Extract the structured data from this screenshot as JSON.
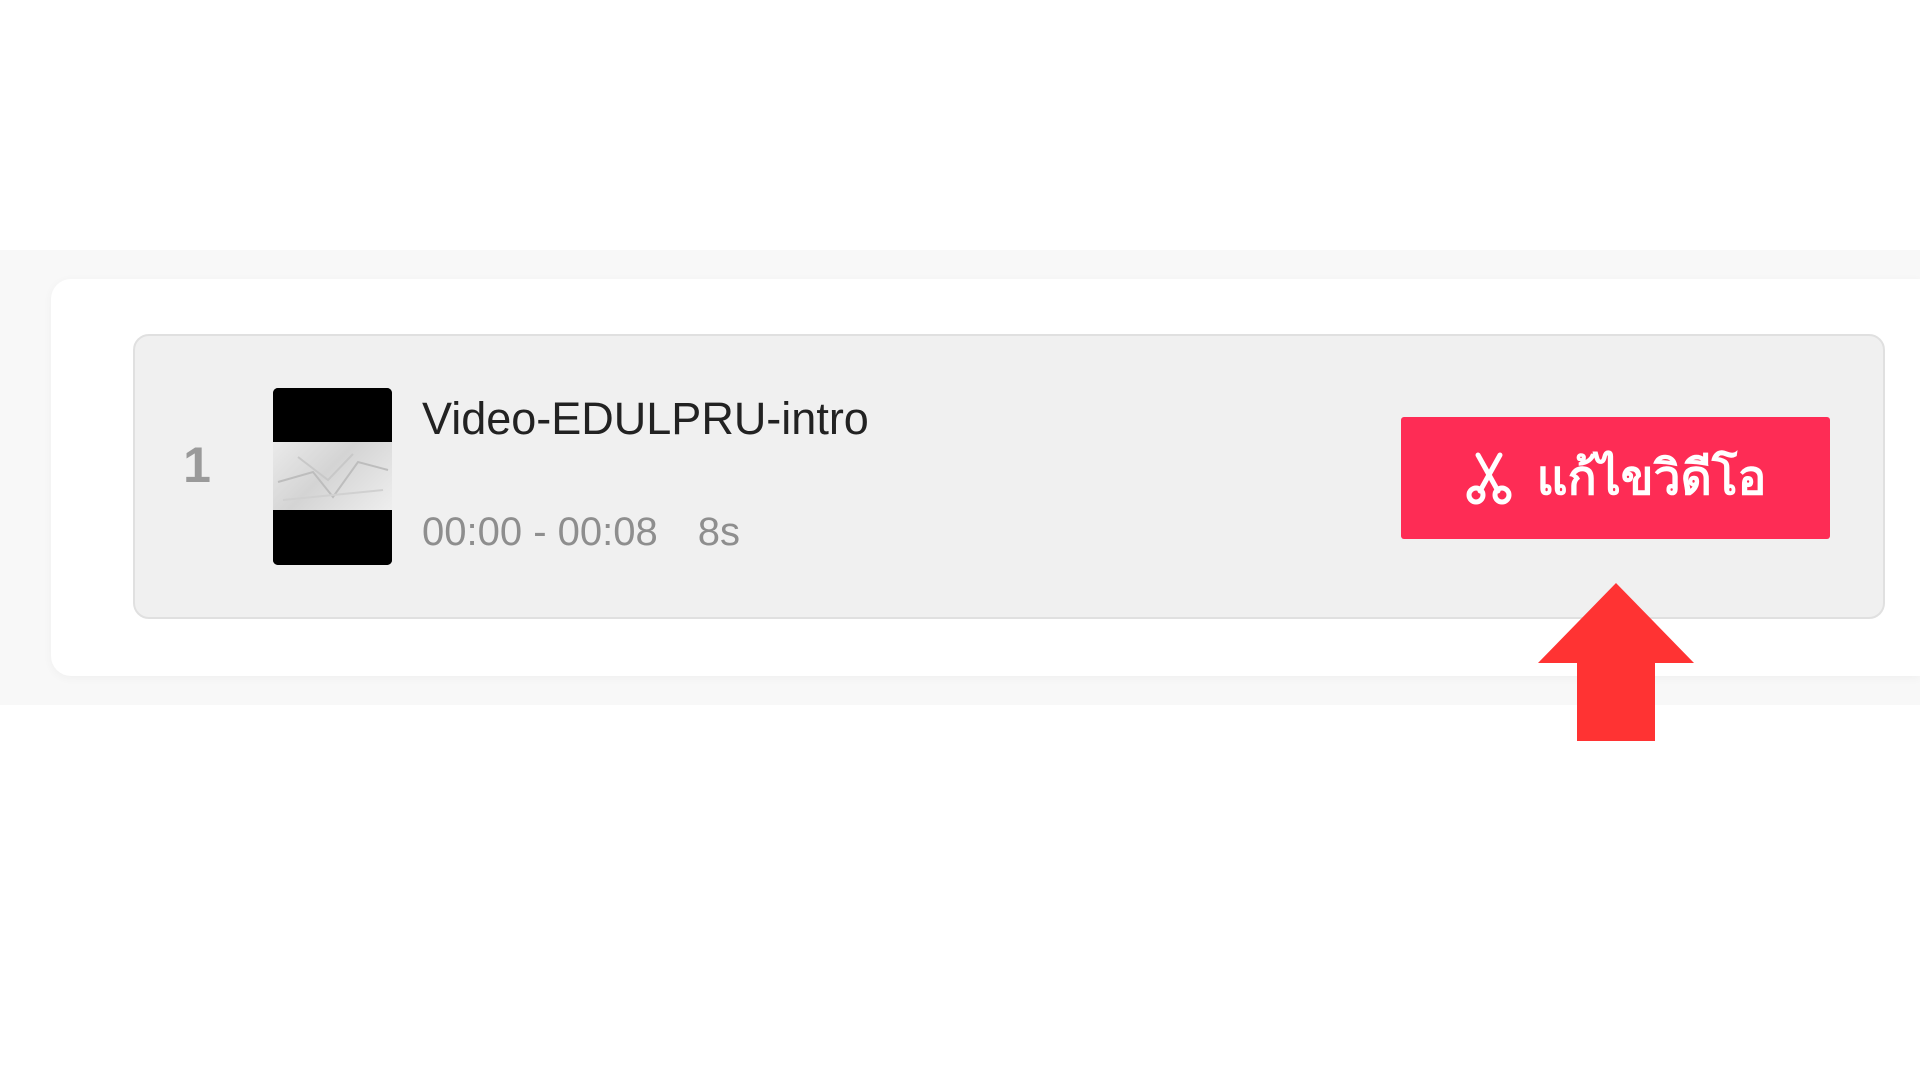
{
  "clip": {
    "index": "1",
    "name": "Video-EDULPRU-intro",
    "time_range": "00:00 - 00:08",
    "duration": "8s",
    "thumbnail_icon": "video-thumbnail"
  },
  "edit_button": {
    "label": "แก้ไขวิดีโอ",
    "icon": "scissors-icon",
    "color": "#fe2c55"
  },
  "annotation": {
    "icon": "arrow-up-icon",
    "color": "#ff3333"
  }
}
